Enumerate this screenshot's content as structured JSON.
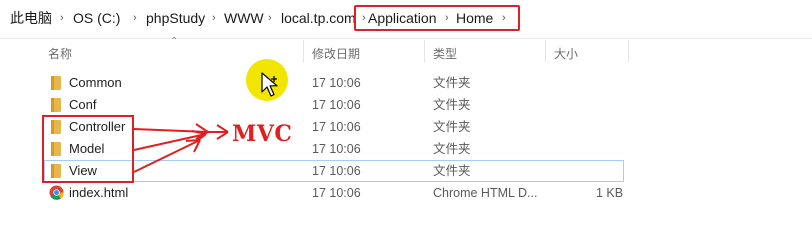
{
  "breadcrumb": {
    "items": [
      "此电脑",
      "OS (C:)",
      "phpStudy",
      "WWW",
      "local.tp.com",
      "Application",
      "Home"
    ],
    "separator": "›"
  },
  "columns": {
    "name": "名称",
    "modified": "修改日期",
    "type": "类型",
    "size": "大小"
  },
  "files": [
    {
      "name": "Common",
      "modified": "17 10:06",
      "type": "文件夹",
      "size": "",
      "icon": "folder-icon"
    },
    {
      "name": "Conf",
      "modified": "17 10:06",
      "type": "文件夹",
      "size": "",
      "icon": "folder-icon"
    },
    {
      "name": "Controller",
      "modified": "17 10:06",
      "type": "文件夹",
      "size": "",
      "icon": "folder-icon"
    },
    {
      "name": "Model",
      "modified": "17 10:06",
      "type": "文件夹",
      "size": "",
      "icon": "folder-icon"
    },
    {
      "name": "View",
      "modified": "17 10:06",
      "type": "文件夹",
      "size": "",
      "icon": "folder-icon",
      "selected": true
    },
    {
      "name": "index.html",
      "modified": "17 10:06",
      "type": "Chrome HTML D...",
      "size": "1 KB",
      "icon": "chrome-icon"
    }
  ],
  "annotation": {
    "label": "MVC",
    "color": "#e02020"
  },
  "colors": {
    "folder": "#e8b64c",
    "highlight": "#e02020",
    "selection_border": "#a9cdf2",
    "cursor_spot": "#f2e600"
  }
}
